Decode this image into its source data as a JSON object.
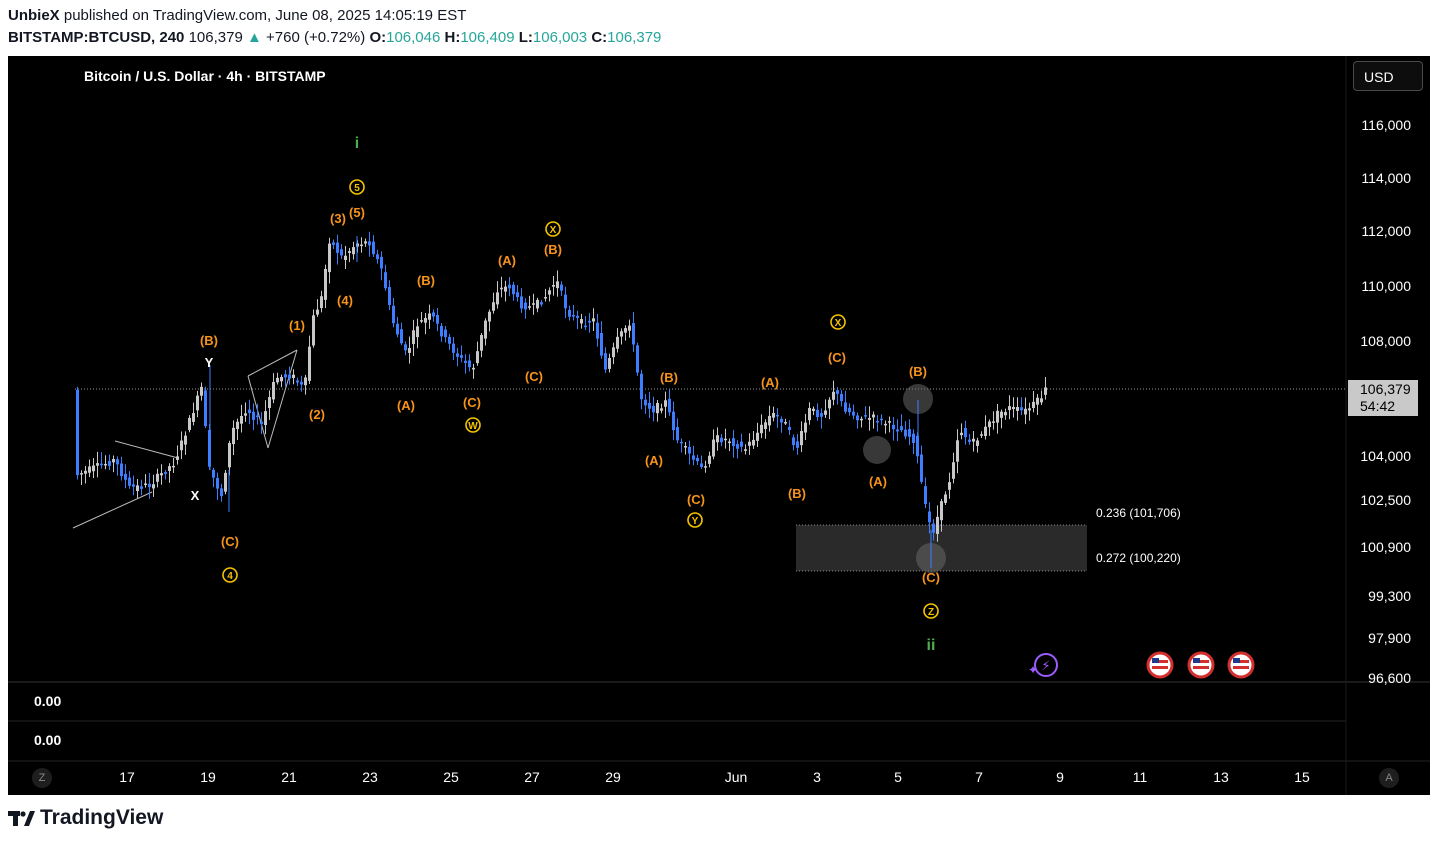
{
  "header": {
    "author": "UnbieX",
    "published_text": "published on TradingView.com, June 08, 2025 14:05:19 EST",
    "symbol": "BITSTAMP:BTCUSD, 240",
    "last_price": "106,379",
    "change_arrow": "▲",
    "change": "+760 (+0.72%)",
    "open_label": "O:",
    "open": "106,046",
    "high_label": "H:",
    "high": "106,409",
    "low_label": "L:",
    "low": "106,003",
    "close_label": "C:",
    "close": "106,379"
  },
  "chart": {
    "title": "Bitcoin / U.S. Dollar · 4h · BITSTAMP",
    "currency_button": "USD",
    "price_label": "106,379",
    "countdown": "54:42",
    "price_axis": [
      "116,000",
      "114,000",
      "112,000",
      "110,000",
      "108,000",
      "106,379",
      "104,000",
      "102,500",
      "100,900",
      "99,300",
      "97,900",
      "96,600"
    ],
    "time_axis": [
      "17",
      "19",
      "21",
      "23",
      "25",
      "27",
      "29",
      "Jun",
      "3",
      "5",
      "7",
      "9",
      "11",
      "13",
      "15"
    ],
    "fib_levels": [
      {
        "label": "0.236 (101,706)"
      },
      {
        "label": "0.272 (100,220)"
      }
    ],
    "wave_labels": [
      "i",
      "ii",
      "(B)",
      "Y",
      "X",
      "(C)",
      "(1)",
      "(2)",
      "(3)",
      "(4)",
      "(5)",
      "(A)",
      "(B)",
      "(C)",
      "(A)",
      "(C)",
      "(B)",
      "(A)",
      "(B)",
      "(C)",
      "(A)",
      "(B)",
      "(C)",
      "(A)",
      "(B)",
      "(C)"
    ],
    "circled_labels": [
      "5",
      "4",
      "W",
      "X",
      "Y",
      "X",
      "Z"
    ],
    "colors": {
      "up": "#c8c8c8",
      "down": "#3d7eff",
      "wave": "#f7931a",
      "circled": "#f5c400",
      "minor_wave": "#4caf50",
      "background": "#000000"
    }
  },
  "indicator": {
    "value1": "0.00",
    "value2": "0.00"
  },
  "footer": {
    "brand": "TradingView",
    "left_button": "Z",
    "right_button": "A"
  }
}
